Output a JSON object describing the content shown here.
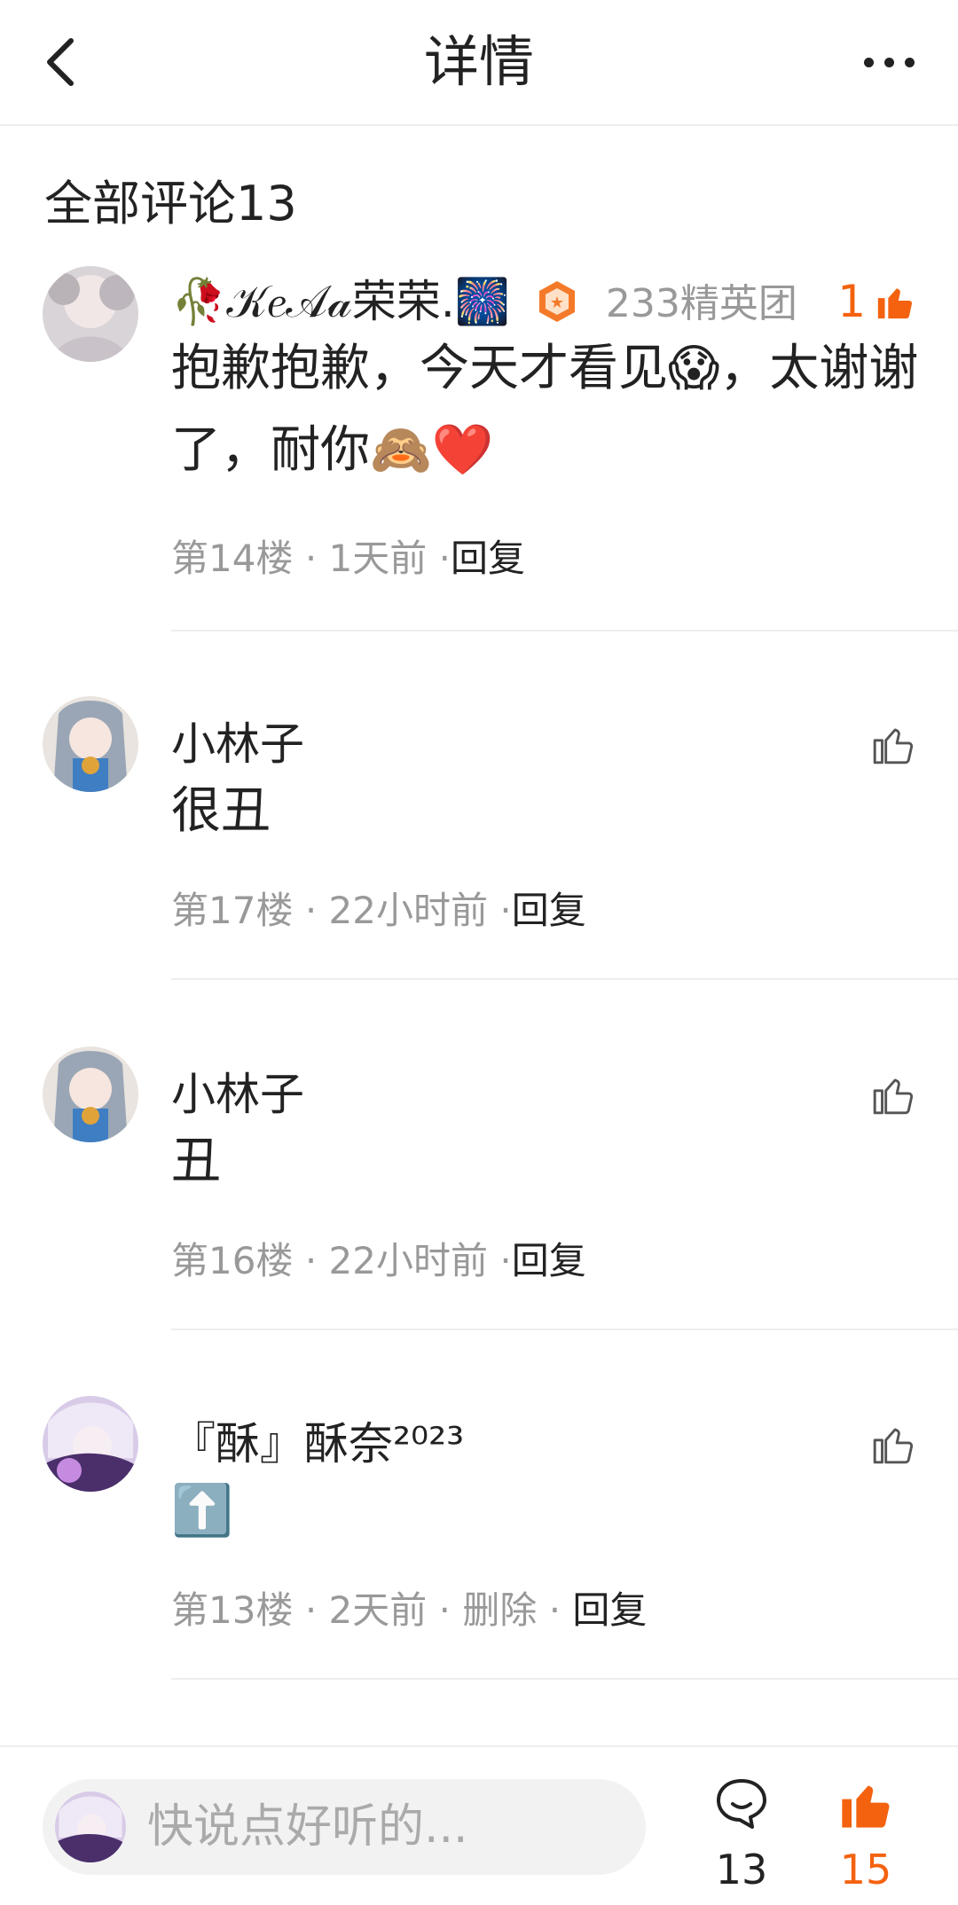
{
  "header": {
    "title": "详情",
    "back_icon": "chevron-left-icon",
    "more_icon": "more-horizontal-icon"
  },
  "section": {
    "title": "全部评论13"
  },
  "comments": [
    {
      "username": "🥀𝒦𝑒𝒜𝒶荣荣.🎆",
      "badge": "233精英团",
      "text": "抱歉抱歉，今天才看见😱，太谢谢了，耐你🙈❤️",
      "floor": "第14楼",
      "time": "1天前",
      "reply": "回复",
      "likes": "1",
      "liked": true
    },
    {
      "username": "小林子",
      "text": "很丑",
      "floor": "第17楼",
      "time": "22小时前",
      "reply": "回复",
      "liked": false
    },
    {
      "username": "小林子",
      "text": "丑",
      "floor": "第16楼",
      "time": "22小时前",
      "reply": "回复",
      "liked": false
    },
    {
      "username": "『酥』酥奈²⁰²³",
      "text": "⬆️",
      "floor": "第13楼",
      "time": "2天前",
      "delete": "删除",
      "reply": "回复",
      "liked": false
    }
  ],
  "bottom_bar": {
    "input_placeholder": "快说点好听的...",
    "comment_count": "13",
    "like_count": "15"
  },
  "colors": {
    "accent": "#f4620f",
    "muted": "#999999",
    "text": "#222222"
  }
}
